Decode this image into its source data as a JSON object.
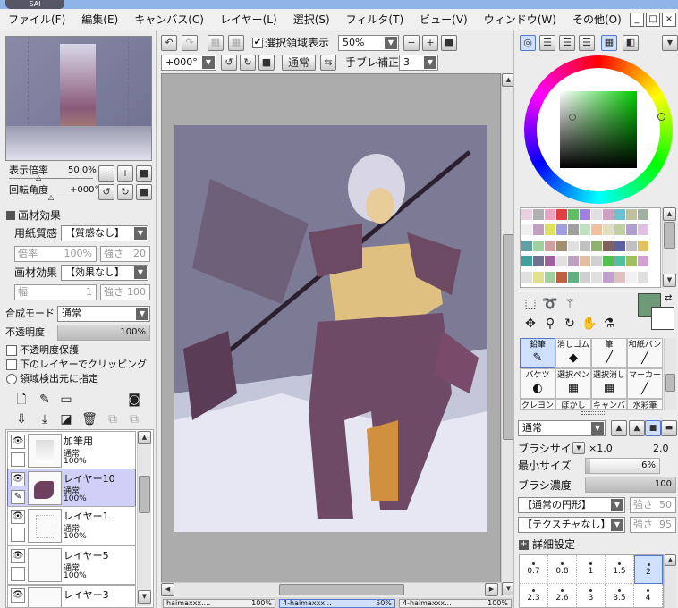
{
  "app": {
    "logo_text": "SAI"
  },
  "menu": [
    "ファイル(F)",
    "編集(E)",
    "キャンバス(C)",
    "レイヤー(L)",
    "選択(S)",
    "フィルタ(T)",
    "ビュー(V)",
    "ウィンドウ(W)",
    "その他(O)"
  ],
  "window_controls": {
    "minimize": "_",
    "restore": "□",
    "close": "×"
  },
  "navigator": {
    "zoom_label": "表示倍率",
    "zoom_value": "50.0%",
    "rotation_label": "回転角度",
    "rotation_value": "+000°"
  },
  "texture": {
    "section_title": "画材効果",
    "paper_label": "用紙質感",
    "paper_value": "【質感なし】",
    "paper_scale_label": "倍率",
    "paper_scale_value": "100%",
    "paper_strength_label": "強さ",
    "paper_strength_value": "20",
    "effect_label": "画材効果",
    "effect_value": "【効果なし】",
    "effect_width_label": "幅",
    "effect_width_value": "1",
    "effect_strength_label": "強さ",
    "effect_strength_value": "100"
  },
  "blend": {
    "mode_label": "合成モード",
    "mode_value": "通常",
    "opacity_label": "不透明度",
    "opacity_value": "100%",
    "preserve_opacity": "不透明度保護",
    "clipping": "下のレイヤーでクリッピング",
    "selection_source": "領域検出元に指定"
  },
  "layers": [
    {
      "name": "加筆用",
      "mode": "通常",
      "opacity": "100%",
      "selected": false
    },
    {
      "name": "レイヤー10",
      "mode": "通常",
      "opacity": "100%",
      "selected": true
    },
    {
      "name": "レイヤー1",
      "mode": "通常",
      "opacity": "100%",
      "selected": false
    },
    {
      "name": "レイヤー5",
      "mode": "通常",
      "opacity": "100%",
      "selected": false
    },
    {
      "name": "レイヤー3",
      "mode": "",
      "opacity": "",
      "selected": false
    }
  ],
  "toolbar": {
    "show_selection_label": "選択領域表示",
    "zoom_value": "50%",
    "rotation_value": "+000°",
    "mode_button": "通常",
    "stabilizer_label": "手ブレ補正",
    "stabilizer_value": "3"
  },
  "tabs": [
    "haimaxxx....",
    "4-haimaxxx...",
    "4-haimaxxx..."
  ],
  "tab_zoom": [
    "100%",
    "50%",
    "100%"
  ],
  "color": {
    "current": "#6f9a78",
    "background": "#ffffff"
  },
  "swatches": [
    "#e8d0e0",
    "#b0b0b0",
    "#f0a0c0",
    "#e04040",
    "#60c060",
    "#a080e0",
    "#e0e0e0",
    "#d0a0c0",
    "#70c0d0",
    "#c0c0a0",
    "#a0b0a0",
    "#f0f0f0",
    "#c0a0c0",
    "#e0e060",
    "#a0a0e0",
    "#a0a0a0",
    "#c0e0c0",
    "#f0c0a0",
    "#e0e0c0",
    "#c0d0a0",
    "#b0a0d0",
    "#e0c0e0",
    "#60a0a0",
    "#a0d0a0",
    "#d0a0a0",
    "#a09070",
    "#e0e0e0",
    "#c0c0c0",
    "#90b070",
    "#806060",
    "#6060a0",
    "#c0c0c0",
    "#e0c060",
    "#40a0a0",
    "#707090",
    "#a060a0",
    "#e0e0e0",
    "#c0a0c0",
    "#e0c0a0",
    "#d0d0d0",
    "#50c050",
    "#50c0a0",
    "#a0c060",
    "#d0a0d0",
    "#e0e0e0",
    "#e0e090",
    "#a0d0a0",
    "#c06040",
    "#60b080",
    "#d0d0d0",
    "#e0e0e0",
    "#c0a0d0",
    "#e0c0c0",
    "#f0f0f0",
    "#e0e0e0"
  ],
  "brushes": [
    {
      "label": "鉛筆",
      "icon": "pencil-icon",
      "glyph": "✎",
      "selected": true
    },
    {
      "label": "消しゴム",
      "icon": "eraser-icon",
      "glyph": "◆",
      "selected": false
    },
    {
      "label": "筆",
      "icon": "brush-icon",
      "glyph": "╱",
      "selected": false
    },
    {
      "label": "和紙バン",
      "icon": "washi-icon",
      "glyph": "╱",
      "selected": false
    },
    {
      "label": "バケツ",
      "icon": "bucket-icon",
      "glyph": "◐",
      "selected": false
    },
    {
      "label": "選択ペン",
      "icon": "select-pen-icon",
      "glyph": "▦",
      "selected": false
    },
    {
      "label": "選択消し",
      "icon": "select-erase-icon",
      "glyph": "▦",
      "selected": false
    },
    {
      "label": "マーカー",
      "icon": "marker-icon",
      "glyph": "╱",
      "selected": false
    },
    {
      "label": "クレヨン",
      "icon": "crayon-icon",
      "glyph": "▮",
      "selected": false
    },
    {
      "label": "ぼかし",
      "icon": "blur-icon",
      "glyph": "◍",
      "selected": false
    },
    {
      "label": "キャンバス",
      "icon": "canvas-icon",
      "glyph": "▤",
      "selected": false
    },
    {
      "label": "水彩筆",
      "icon": "watercolor-icon",
      "glyph": "╱",
      "selected": false
    }
  ],
  "brush_settings": {
    "mode_value": "通常",
    "size_label": "ブラシサイズ",
    "size_multiplier": "×1.0",
    "size_value": "2.0",
    "min_size_label": "最小サイズ",
    "min_size_value": "6%",
    "density_label": "ブラシ濃度",
    "density_value": "100",
    "shape_value": "【通常の円形】",
    "shape_strength_label": "強さ",
    "shape_strength_value": "50",
    "texture_value": "【テクスチャなし】",
    "texture_strength_label": "強さ",
    "texture_strength_value": "95",
    "detail_label": "詳細設定"
  },
  "brush_sizes": [
    {
      "value": "0.7",
      "selected": false
    },
    {
      "value": "0.8",
      "selected": false
    },
    {
      "value": "1",
      "selected": false
    },
    {
      "value": "1.5",
      "selected": false
    },
    {
      "value": "2",
      "selected": true
    }
  ],
  "brush_sizes_row2": [
    "2.3",
    "2.6",
    "3",
    "3.5",
    "4"
  ]
}
